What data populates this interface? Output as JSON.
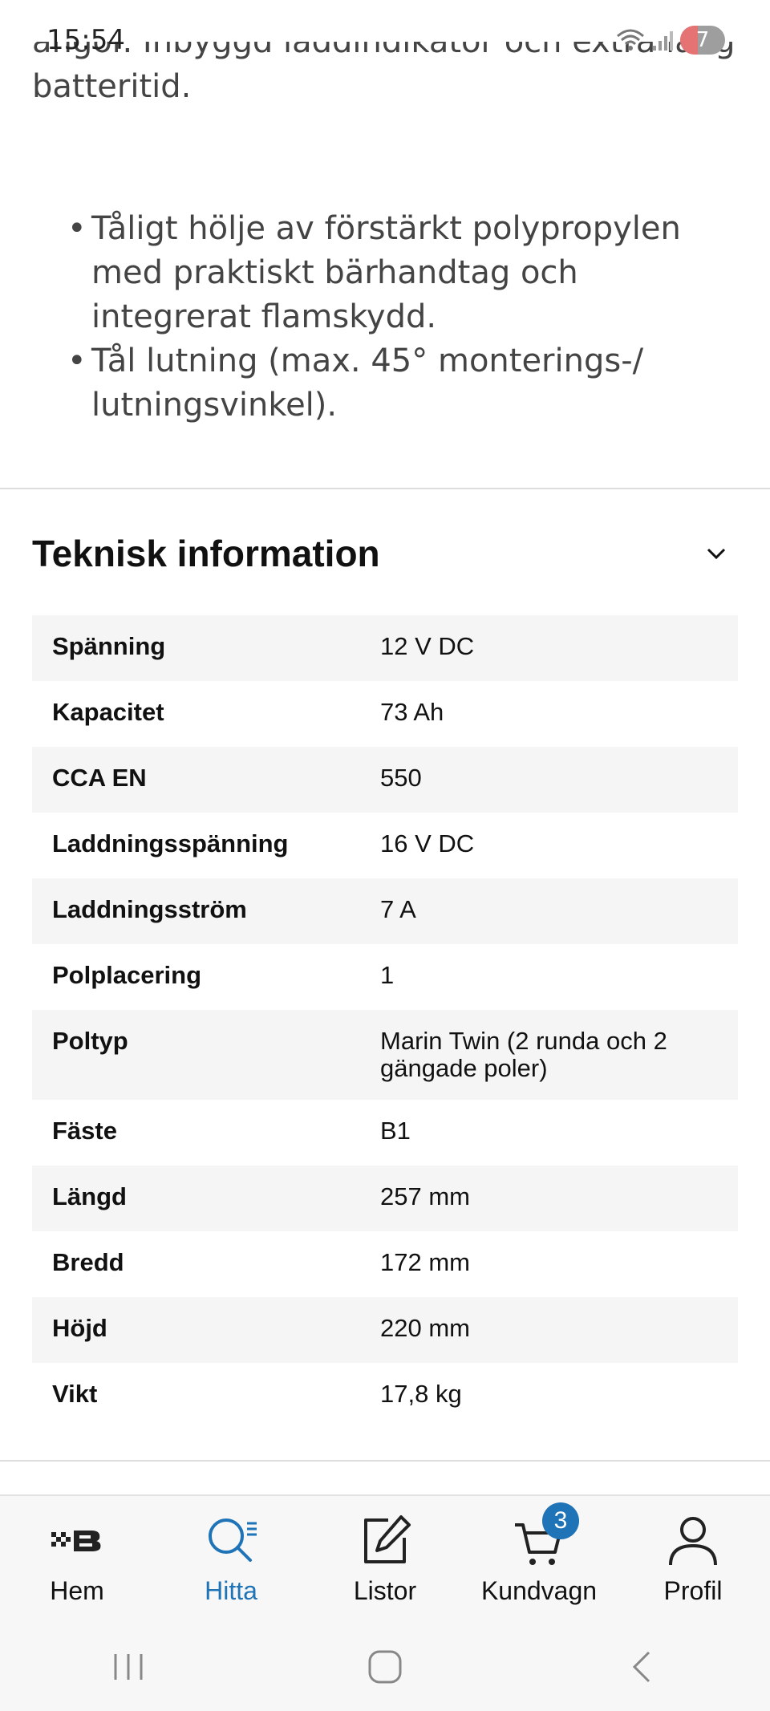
{
  "status_bar": {
    "time": "15:54",
    "notification_count": "7"
  },
  "description": {
    "cut_line": "angor. Inbyggd laddindikator och extra lång",
    "last_line": "batteritid.",
    "bullets": [
      "Tåligt hölje av förstärkt polypropylen med praktiskt bärhandtag och integrerat flamskydd.",
      "Tål lutning (max. 45° monterings-/ lutningsvinkel)."
    ]
  },
  "tech_info": {
    "title": "Teknisk information",
    "rows": [
      {
        "label": "Spänning",
        "value": "12 V DC"
      },
      {
        "label": "Kapacitet",
        "value": "73 Ah"
      },
      {
        "label": "CCA EN",
        "value": "550"
      },
      {
        "label": "Laddningsspänning",
        "value": "16 V DC"
      },
      {
        "label": "Laddningsström",
        "value": "7 A"
      },
      {
        "label": "Polplacering",
        "value": "1"
      },
      {
        "label": "Poltyp",
        "value": "Marin Twin (2 runda och 2 gängade poler)"
      },
      {
        "label": "Fäste",
        "value": "B1"
      },
      {
        "label": "Längd",
        "value": "257 mm"
      },
      {
        "label": "Bredd",
        "value": "172 mm"
      },
      {
        "label": "Höjd",
        "value": "220 mm"
      },
      {
        "label": "Vikt",
        "value": "17,8 kg"
      }
    ]
  },
  "tab_bar": {
    "tabs": [
      {
        "label": "Hem",
        "icon": "brand-logo-icon"
      },
      {
        "label": "Hitta",
        "icon": "search-list-icon",
        "active": true
      },
      {
        "label": "Listor",
        "icon": "edit-icon"
      },
      {
        "label": "Kundvagn",
        "icon": "cart-icon",
        "badge": "3"
      },
      {
        "label": "Profil",
        "icon": "person-icon"
      }
    ],
    "accent_color": "#1f73b7"
  },
  "system_nav": {
    "buttons": [
      "recents-icon",
      "home-icon",
      "back-icon"
    ]
  }
}
